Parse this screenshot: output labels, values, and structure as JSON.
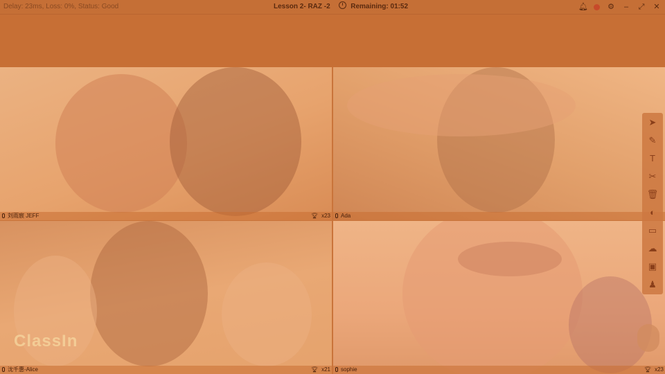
{
  "topbar": {
    "status": "Delay: 23ms, Loss: 0%, Status: Good",
    "lesson": "Lesson 2- RAZ -2",
    "remaining": "Remaining: 01:52"
  },
  "window_controls": [
    "bell-icon",
    "record-icon",
    "gear-icon",
    "minimize-icon",
    "fullscreen-icon",
    "close-icon"
  ],
  "participants": [
    {
      "name": "刘雨宸  JEFF",
      "trophies": "x23"
    },
    {
      "name": "Ada",
      "trophies": ""
    },
    {
      "name": "沈千惠-Alice",
      "trophies": "x21"
    },
    {
      "name": "sophie",
      "trophies": "x23"
    }
  ],
  "watermark": "ClassIn",
  "toolbar": [
    "cursor-icon",
    "pen-icon",
    "text-icon",
    "scissors-icon",
    "trash-icon",
    "camera-icon",
    "chat-icon",
    "cloud-icon",
    "toolbox-icon",
    "person-icon"
  ],
  "colors": {
    "overlay": "#c9743a",
    "accent": "#5a2a0f"
  }
}
